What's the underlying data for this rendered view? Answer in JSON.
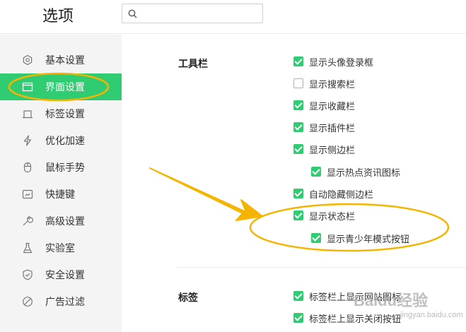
{
  "header": {
    "title": "选项",
    "search_value": "",
    "search_placeholder": ""
  },
  "sidebar": {
    "items": [
      {
        "label": "基本设置",
        "icon": "gear-icon",
        "active": false
      },
      {
        "label": "界面设置",
        "icon": "window-icon",
        "active": true
      },
      {
        "label": "标签设置",
        "icon": "tab-icon",
        "active": false
      },
      {
        "label": "优化加速",
        "icon": "lightning-icon",
        "active": false
      },
      {
        "label": "鼠标手势",
        "icon": "mouse-icon",
        "active": false
      },
      {
        "label": "快捷键",
        "icon": "keyboard-icon",
        "active": false
      },
      {
        "label": "高级设置",
        "icon": "wrench-icon",
        "active": false
      },
      {
        "label": "实验室",
        "icon": "flask-icon",
        "active": false
      },
      {
        "label": "安全设置",
        "icon": "shield-icon",
        "active": false
      },
      {
        "label": "广告过滤",
        "icon": "block-icon",
        "active": false
      }
    ]
  },
  "sections": {
    "toolbar": {
      "title": "工具栏",
      "options": [
        {
          "label": "显示头像登录框",
          "checked": true
        },
        {
          "label": "显示搜索栏",
          "checked": false
        },
        {
          "label": "显示收藏栏",
          "checked": true
        },
        {
          "label": "显示插件栏",
          "checked": true
        },
        {
          "label": "显示侧边栏",
          "checked": true
        },
        {
          "label": "显示热点资讯图标",
          "checked": true
        },
        {
          "label": "自动隐藏侧边栏",
          "checked": true
        },
        {
          "label": "显示状态栏",
          "checked": true
        },
        {
          "label": "显示青少年模式按钮",
          "checked": true
        }
      ]
    },
    "tabs": {
      "title": "标签",
      "options": [
        {
          "label": "标签栏上显示网站图标",
          "checked": true
        },
        {
          "label": "标签栏上显示关闭按钮",
          "checked": true
        }
      ]
    }
  },
  "watermark": {
    "text": "Baidu经验",
    "sub": "jingyan.baidu.com"
  },
  "colors": {
    "accent": "#2fcc71",
    "annotation": "#f5b400"
  }
}
